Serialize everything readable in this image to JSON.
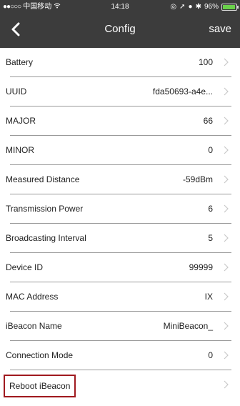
{
  "status_bar": {
    "carrier": "中国移动",
    "time": "14:18",
    "battery_percent": "96%",
    "battery_fill_fraction": 0.96
  },
  "nav": {
    "title": "Config",
    "save_label": "save"
  },
  "rows": [
    {
      "label": "Battery",
      "value": "100"
    },
    {
      "label": "UUID",
      "value": "fda50693-a4e..."
    },
    {
      "label": "MAJOR",
      "value": "66"
    },
    {
      "label": "MINOR",
      "value": "0"
    },
    {
      "label": "Measured Distance",
      "value": "-59dBm"
    },
    {
      "label": "Transmission Power",
      "value": "6"
    },
    {
      "label": "Broadcasting Interval",
      "value": "5"
    },
    {
      "label": "Device ID",
      "value": "99999"
    },
    {
      "label": "MAC Address",
      "value": "IX"
    },
    {
      "label": "iBeacon Name",
      "value": "MiniBeacon_"
    },
    {
      "label": "Connection Mode",
      "value": "0"
    },
    {
      "label": "Reboot iBeacon",
      "value": ""
    }
  ],
  "colors": {
    "nav_background": "#3c3c3c",
    "highlight_border": "#a0191f",
    "separator": "#9a9a9a"
  }
}
